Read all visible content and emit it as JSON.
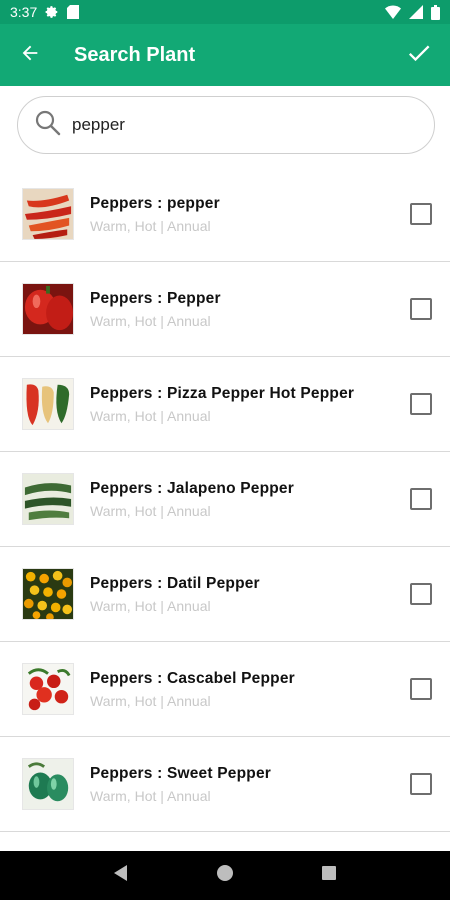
{
  "status_bar": {
    "time": "3:37",
    "icons": [
      "gear-icon",
      "sd-card-icon",
      "wifi-icon",
      "signal-icon",
      "battery-icon"
    ]
  },
  "app_bar": {
    "title": "Search Plant",
    "back_icon": "arrow-back-icon",
    "confirm_icon": "checkmark-icon",
    "color": "#12a975"
  },
  "search": {
    "value": "pepper",
    "icon": "search-icon"
  },
  "plants": [
    {
      "name": "Peppers : pepper",
      "meta": "Warm, Hot | Annual",
      "thumb": "red-peppers",
      "checked": false
    },
    {
      "name": "Peppers : Pepper",
      "meta": "Warm, Hot | Annual",
      "thumb": "red-bell-pepper",
      "checked": false
    },
    {
      "name": "Peppers : Pizza Pepper Hot Pepper",
      "meta": "Warm, Hot | Annual",
      "thumb": "pizza-pepper",
      "checked": false
    },
    {
      "name": "Peppers : Jalapeno Pepper",
      "meta": "Warm, Hot | Annual",
      "thumb": "jalapeno",
      "checked": false
    },
    {
      "name": "Peppers : Datil Pepper",
      "meta": "Warm, Hot | Annual",
      "thumb": "datil",
      "checked": false
    },
    {
      "name": "Peppers : Cascabel Pepper",
      "meta": "Warm, Hot | Annual",
      "thumb": "cascabel",
      "checked": false
    },
    {
      "name": "Peppers : Sweet Pepper",
      "meta": "Warm, Hot | Annual",
      "thumb": "sweet-pepper",
      "checked": false
    }
  ],
  "nav_bar": {
    "icons": [
      "back-triangle-icon",
      "home-circle-icon",
      "recents-square-icon"
    ]
  }
}
